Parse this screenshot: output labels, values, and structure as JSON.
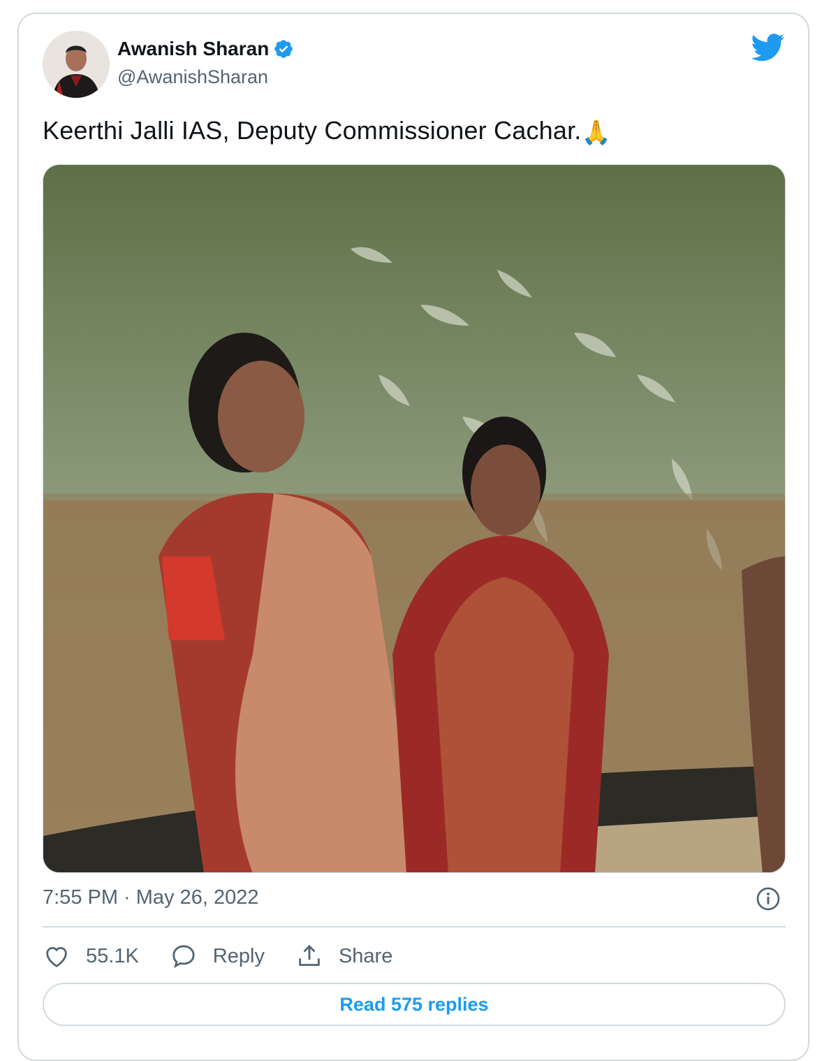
{
  "author": {
    "name": "Awanish Sharan",
    "handle": "@AwanishSharan",
    "verified": true
  },
  "tweet": {
    "text": "Keerthi Jalli IAS, Deputy Commissioner Cachar.",
    "emoji": "🙏",
    "timestamp": "7:55 PM · May 26, 2022"
  },
  "actions": {
    "likes": "55.1K",
    "reply_label": "Reply",
    "share_label": "Share"
  },
  "read_replies_label": "Read 575 replies",
  "colors": {
    "accent": "#1d9bf0",
    "text_primary": "#0f1419",
    "text_secondary": "#536471",
    "border": "#cfd9de"
  },
  "icons": [
    "verified-badge-icon",
    "twitter-bird-icon",
    "info-icon",
    "heart-icon",
    "reply-bubble-icon",
    "share-icon"
  ]
}
